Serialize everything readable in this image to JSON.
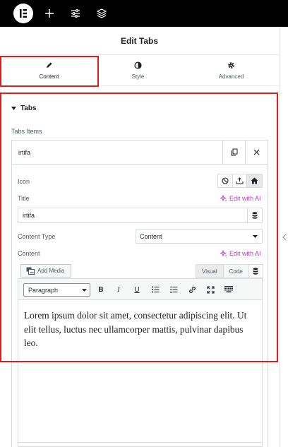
{
  "panel": {
    "title": "Edit Tabs"
  },
  "tabs": [
    {
      "label": "Content",
      "icon": "pencil-icon",
      "active": true
    },
    {
      "label": "Style",
      "icon": "half-circle-icon",
      "active": false
    },
    {
      "label": "Advanced",
      "icon": "gear-icon",
      "active": false
    }
  ],
  "section": {
    "title": "Tabs",
    "items_label": "Tabs Items"
  },
  "item": {
    "title": "irtifa",
    "icon_label": "Icon",
    "title_label": "Title",
    "title_value": "irtifa",
    "edit_with_ai": "Edit with AI",
    "content_type_label": "Content Type",
    "content_type_value": "Content",
    "content_label": "Content"
  },
  "editor": {
    "add_media": "Add Media",
    "visual_tab": "Visual",
    "code_tab": "Code",
    "format_value": "Paragraph",
    "bold": "B",
    "italic": "I",
    "underline": "U",
    "body": "Lorem ipsum dolor sit amet, consectetur adipiscing elit. Ut elit tellus, luctus nec ullamcorper mattis, pulvinar dapibus leo."
  },
  "colors": {
    "topbar": "#000000",
    "highlight": "#e01b1b",
    "ai": "#c036c0"
  }
}
